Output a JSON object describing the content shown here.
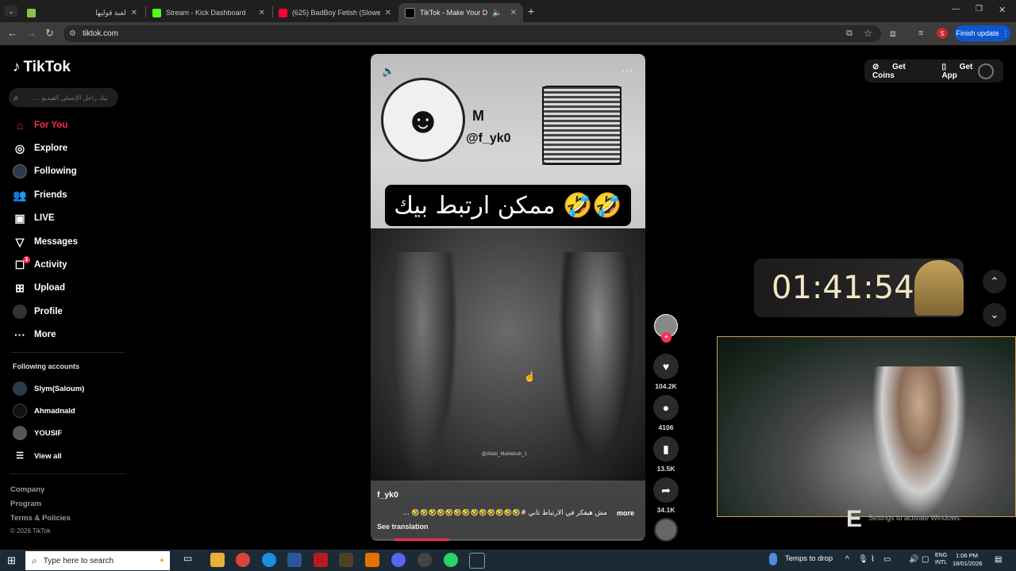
{
  "browser": {
    "tabs": [
      {
        "label": "لعبة قوليها",
        "color": "#8bc34a",
        "active": false
      },
      {
        "label": "Stream - Kick Dashboard",
        "color": "#53fc18",
        "active": false
      },
      {
        "label": "(625) BadBoy Fetish (Slowed D",
        "color": "#ff0033",
        "active": false
      },
      {
        "label": "TikTok - Make Your Day",
        "color": "#000000",
        "active": true
      }
    ],
    "new_tab": "+",
    "url": "tiktok.com",
    "finish_update": "Finish update",
    "profile_letter": "S"
  },
  "tiktok": {
    "logo": "TikTok",
    "search_placeholder": "بيك راحل الإنسلي الفيديو ...",
    "nav": [
      {
        "label": "For You",
        "icon": "home-icon",
        "active": true
      },
      {
        "label": "Explore",
        "icon": "compass-icon"
      },
      {
        "label": "Following",
        "icon": "following-avatar-icon"
      },
      {
        "label": "Friends",
        "icon": "friends-icon"
      },
      {
        "label": "LIVE",
        "icon": "live-icon"
      },
      {
        "label": "Messages",
        "icon": "messages-icon"
      },
      {
        "label": "Activity",
        "icon": "activity-icon",
        "badge": "1"
      },
      {
        "label": "Upload",
        "icon": "upload-icon"
      },
      {
        "label": "Profile",
        "icon": "profile-icon"
      },
      {
        "label": "More",
        "icon": "more-icon"
      }
    ],
    "following_title": "Following accounts",
    "following_accounts": [
      "Slym(Saloum)",
      "Ahmadnald",
      "YOUSIF"
    ],
    "view_all": "View all",
    "footer": [
      "Company",
      "Program",
      "Terms & Policies"
    ],
    "copyright": "© 2026 TikTok",
    "get_coins": "Get Coins",
    "get_app": "Get App"
  },
  "video": {
    "overlay_handle": "@f_yk0",
    "overlay_logo": "M",
    "overlay_text": "ممكن ارتبط بيك 🤣🤣",
    "watermark": "@Abdo_Mamdouh_1",
    "author": "f_yk0",
    "description": "مش هيفكر في الارتباط تاني #🤣🤣🤣🤣🤣🤣🤣🤣🤣🤣🤣🤣🤣 ...",
    "more": "more",
    "see_translation": "See translation",
    "progress": 0.2,
    "likes": "104.2K",
    "comments": "4106",
    "saves": "13.5K",
    "shares": "34.1K"
  },
  "stream": {
    "timer": "01:41:54",
    "activate_windows": "Settings to activate Windows."
  },
  "taskbar": {
    "search_placeholder": "Type here to search",
    "weather": "Temps to drop",
    "lang_top": "ENG",
    "lang_bottom": "INTL",
    "time": "1:06 PM",
    "date": "18/01/2026"
  }
}
